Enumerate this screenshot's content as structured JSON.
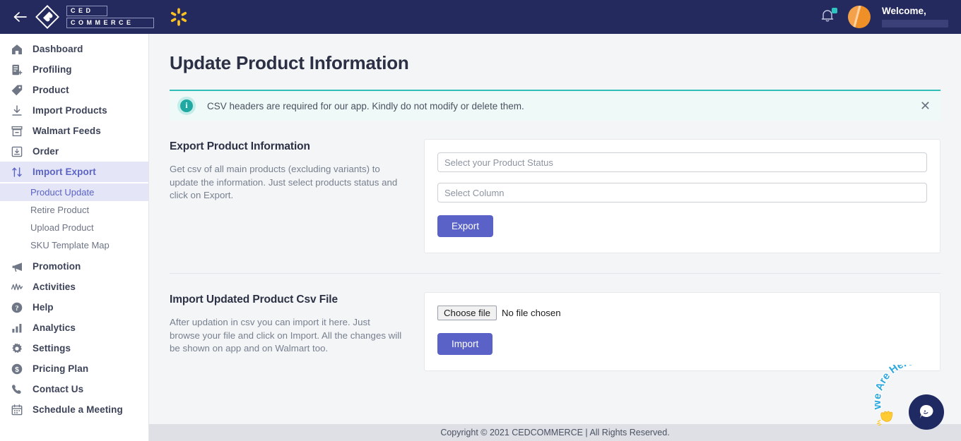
{
  "topbar": {
    "back_icon": "arrow-left-icon",
    "brand_line1": "CED",
    "brand_line2": "COMMERCE",
    "marketplace_icon": "walmart-spark-icon",
    "bell_icon": "notification-bell-icon",
    "welcome_text": "Welcome,",
    "avatar_icon": "user-avatar"
  },
  "sidebar": {
    "items": [
      {
        "label": "Dashboard",
        "icon": "home-icon",
        "active": false
      },
      {
        "label": "Profiling",
        "icon": "profile-add-icon",
        "active": false
      },
      {
        "label": "Product",
        "icon": "tag-icon",
        "active": false
      },
      {
        "label": "Import Products",
        "icon": "download-icon",
        "active": false
      },
      {
        "label": "Walmart Feeds",
        "icon": "archive-box-icon",
        "active": false
      },
      {
        "label": "Order",
        "icon": "inbox-download-icon",
        "active": false
      },
      {
        "label": "Import Export",
        "icon": "arrows-up-down-icon",
        "active": true
      },
      {
        "label": "Promotion",
        "icon": "megaphone-icon",
        "active": false
      },
      {
        "label": "Activities",
        "icon": "pulse-icon",
        "active": false
      },
      {
        "label": "Help",
        "icon": "question-circle-icon",
        "active": false
      },
      {
        "label": "Analytics",
        "icon": "bar-chart-icon",
        "active": false
      },
      {
        "label": "Settings",
        "icon": "gear-icon",
        "active": false
      },
      {
        "label": "Pricing Plan",
        "icon": "dollar-circle-icon",
        "active": false
      },
      {
        "label": "Contact Us",
        "icon": "phone-icon",
        "active": false
      },
      {
        "label": "Schedule a Meeting",
        "icon": "calendar-icon",
        "active": false
      }
    ],
    "sub_items": [
      {
        "label": "Product Update",
        "active": true
      },
      {
        "label": "Retire Product",
        "active": false
      },
      {
        "label": "Upload Product",
        "active": false
      },
      {
        "label": "SKU Template Map",
        "active": false
      }
    ]
  },
  "main": {
    "page_title": "Update Product Information",
    "banner": {
      "icon": "info-icon",
      "message": "CSV headers are required for our app. Kindly do not modify or delete them.",
      "close_icon": "close-icon"
    },
    "export_section": {
      "title": "Export Product Information",
      "description": "Get csv of all main products (excluding variants) to update the information. Just select products status and click on Export.",
      "status_placeholder": "Select your Product Status",
      "status_value": "",
      "column_placeholder": "Select Column",
      "column_value": "",
      "button_label": "Export"
    },
    "import_section": {
      "title": "Import Updated Product Csv File",
      "description": "After updation in csv you can import it here. Just browse your file and click on Import. All the changes will be shown on app and on Walmart too.",
      "choose_file_label": "Choose file",
      "file_status": "No file chosen",
      "button_label": "Import"
    }
  },
  "footer": {
    "copyright": "Copyright © 2021 CEDCOMMERCE | All Rights Reserved."
  },
  "chat_widget": {
    "label": "We Are Here!",
    "hand_icon": "waving-hand-icon",
    "bubble_icon": "chat-bubble-icon"
  },
  "colors": {
    "topbar_bg": "#252a5e",
    "accent_purple": "#5a62c8",
    "active_nav_bg": "#e4e6f7",
    "banner_bg": "#effaf8",
    "banner_border": "#2fbfb8",
    "walmart_yellow": "#ffc220",
    "avatar_orange": "#f0922f"
  }
}
